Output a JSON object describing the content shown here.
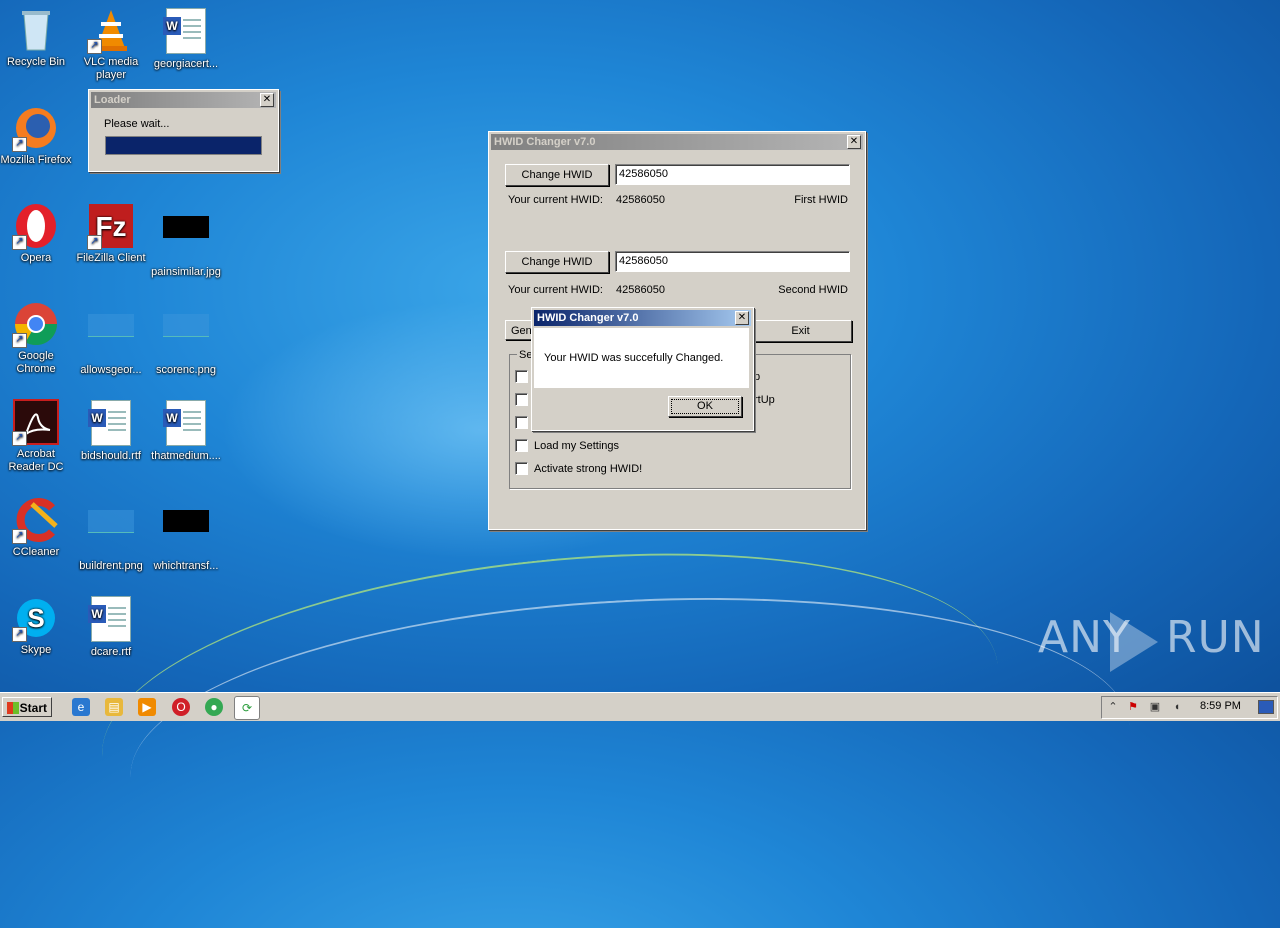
{
  "desktop": {
    "icons": [
      {
        "label": "Recycle Bin",
        "icon": "recycle-bin-icon"
      },
      {
        "label": "VLC media player",
        "icon": "vlc-icon"
      },
      {
        "label": "georgiacert...",
        "icon": "word-document-icon"
      },
      {
        "label": "Mozilla Firefox",
        "icon": "firefox-icon"
      },
      {
        "label": "Opera",
        "icon": "opera-icon"
      },
      {
        "label": "FileZilla Client",
        "icon": "filezilla-icon"
      },
      {
        "label": "painsimilar.jpg",
        "icon": "image-file-icon"
      },
      {
        "label": "Google Chrome",
        "icon": "chrome-icon"
      },
      {
        "label": "allowsgeor...",
        "icon": "image-file-icon"
      },
      {
        "label": "scorenc.png",
        "icon": "image-file-icon"
      },
      {
        "label": "Acrobat Reader DC",
        "icon": "acrobat-icon"
      },
      {
        "label": "bidshould.rtf",
        "icon": "word-document-icon"
      },
      {
        "label": "thatmedium....",
        "icon": "word-document-icon"
      },
      {
        "label": "CCleaner",
        "icon": "ccleaner-icon"
      },
      {
        "label": "buildrent.png",
        "icon": "image-file-icon"
      },
      {
        "label": "whichtransf...",
        "icon": "image-file-icon"
      },
      {
        "label": "Skype",
        "icon": "skype-icon"
      },
      {
        "label": "dcare.rtf",
        "icon": "word-document-icon"
      }
    ]
  },
  "loader": {
    "title": "Loader",
    "message": "Please wait...",
    "progress": 1.0
  },
  "hwid_window": {
    "title": "HWID Changer v7.0",
    "change_button_1": "Change HWID",
    "field_1": "42586050",
    "current_label_1": "Your current HWID:",
    "current_value_1": "42586050",
    "tag_1": "First HWID",
    "change_button_2": "Change HWID",
    "field_2": "42586050",
    "current_label_2": "Your current HWID:",
    "current_value_2": "42586050",
    "tag_2": "Second HWID",
    "gen_button_partial": "Gen",
    "exit_button": "Exit",
    "group_label_partial": "Se",
    "checkbox_partial_1": "p",
    "checkbox_partial_2": "rtUp",
    "checkbox_load": "Load my Settings",
    "checkbox_strong": "Activate strong HWID!"
  },
  "dialog": {
    "title": "HWID Changer v7.0",
    "message": "Your HWID was succefully Changed.",
    "ok_button": "OK"
  },
  "taskbar": {
    "start_label": "Start",
    "clock": "8:59 PM",
    "pinned": [
      "ie-icon",
      "explorer-icon",
      "media-player-icon",
      "opera-icon",
      "chrome-icon",
      "hwid-changer-icon"
    ]
  },
  "watermark": {
    "left": "ANY",
    "right": "RUN"
  }
}
